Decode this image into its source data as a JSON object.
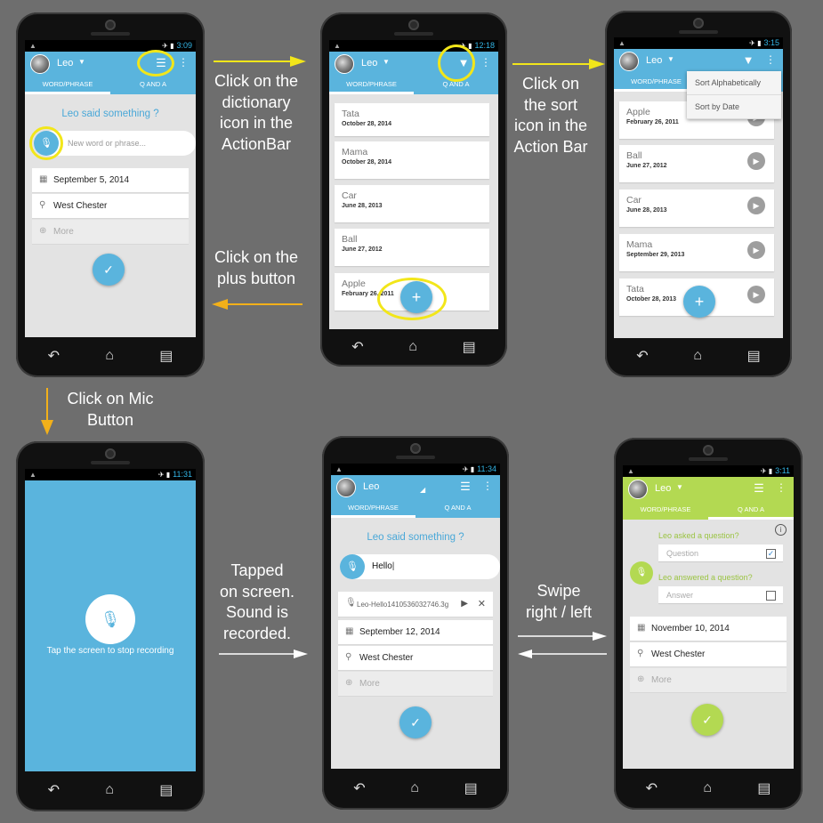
{
  "captions": {
    "dictionary": [
      "Click on the",
      "dictionary",
      "icon in the",
      "ActionBar"
    ],
    "sort": [
      "Click on",
      "the sort",
      "icon in the",
      "Action Bar"
    ],
    "plus": [
      "Click on the",
      "plus button"
    ],
    "mic": [
      "Click on Mic",
      "Button"
    ],
    "tapped": [
      "Tapped",
      "on screen.",
      "Sound is",
      "recorded."
    ],
    "swipe": [
      "Swipe",
      "right / left"
    ]
  },
  "common": {
    "user_name": "Leo",
    "tab_word": "WORD/PHRASE",
    "tab_qa": "Q AND A",
    "more_label": "More",
    "location": "West Chester"
  },
  "phone1": {
    "time": "3:09",
    "prompt": "Leo said something ?",
    "input_placeholder": "New word or phrase...",
    "date": "September 5, 2014"
  },
  "phone2": {
    "time": "12:18",
    "items": [
      {
        "word": "Tata",
        "date": "October 28, 2014"
      },
      {
        "word": "Mama",
        "date": "October 28, 2014"
      },
      {
        "word": "Car",
        "date": "June 28, 2013"
      },
      {
        "word": "Ball",
        "date": "June 27, 2012"
      },
      {
        "word": "Apple",
        "date": "February 26, 2011"
      }
    ]
  },
  "phone3": {
    "time": "3:15",
    "menu": [
      "Sort Alphabetically",
      "Sort by Date"
    ],
    "items": [
      {
        "word": "Apple",
        "date": "February 26, 2011"
      },
      {
        "word": "Ball",
        "date": "June 27, 2012"
      },
      {
        "word": "Car",
        "date": "June 28, 2013"
      },
      {
        "word": "Mama",
        "date": "September 29, 2013"
      },
      {
        "word": "Tata",
        "date": "October 28, 2013"
      }
    ]
  },
  "phone4": {
    "time": "11:31",
    "hint": "Tap the screen to stop recording"
  },
  "phone5": {
    "time": "11:34",
    "prompt": "Leo said something ?",
    "input_value": "Hello",
    "recording_file": "Leo-Hello1410536032746.3g",
    "date": "September 12, 2014"
  },
  "phone6": {
    "time": "3:11",
    "question_label": "Leo asked a question?",
    "question_placeholder": "Question",
    "answer_label": "Leo answered a question?",
    "answer_placeholder": "Answer",
    "date": "November 10, 2014"
  },
  "colors": {
    "accent_blue": "#5ab4dd",
    "accent_green": "#b3d952",
    "highlight_yellow": "#f2e61a",
    "background": "#6e6e6e"
  }
}
